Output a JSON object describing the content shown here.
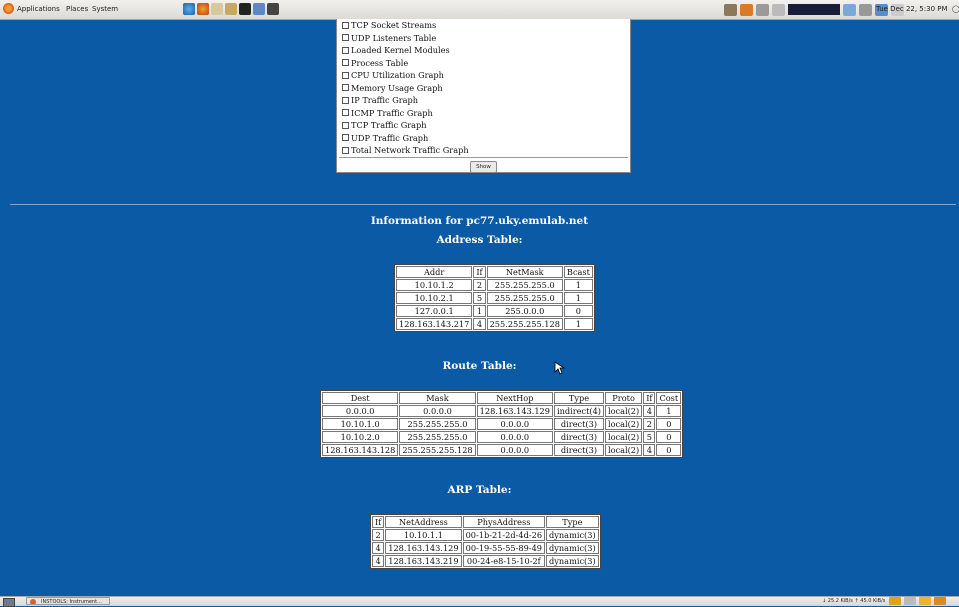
{
  "top_panel": {
    "menus": [
      "Applications",
      "Places",
      "System"
    ],
    "clock": "Tue Dec 22,  5:30 PM",
    "user": "nas"
  },
  "checkbox_options": [
    "TCP Socket Streams",
    "UDP Listeners Table",
    "Loaded Kernel Modules",
    "Process Table",
    "CPU Utilization Graph",
    "Memory Usage Graph",
    "IP Traffic Graph",
    "ICMP Traffic Graph",
    "TCP Traffic Graph",
    "UDP Traffic Graph",
    "Total Network Traffic Graph"
  ],
  "show_button": "Show",
  "info_title": "Information for pc77.uky.emulab.net",
  "address_table": {
    "title": "Address Table:",
    "headers": [
      "Addr",
      "If",
      "NetMask",
      "Bcast"
    ],
    "rows": [
      [
        "10.10.1.2",
        "2",
        "255.255.255.0",
        "1"
      ],
      [
        "10.10.2.1",
        "5",
        "255.255.255.0",
        "1"
      ],
      [
        "127.0.0.1",
        "1",
        "255.0.0.0",
        "0"
      ],
      [
        "128.163.143.217",
        "4",
        "255.255.255.128",
        "1"
      ]
    ]
  },
  "route_table": {
    "title": "Route Table:",
    "headers": [
      "Dest",
      "Mask",
      "NextHop",
      "Type",
      "Proto",
      "If",
      "Cost"
    ],
    "rows": [
      [
        "0.0.0.0",
        "0.0.0.0",
        "128.163.143.129",
        "indirect(4)",
        "local(2)",
        "4",
        "1"
      ],
      [
        "10.10.1.0",
        "255.255.255.0",
        "0.0.0.0",
        "direct(3)",
        "local(2)",
        "2",
        "0"
      ],
      [
        "10.10.2.0",
        "255.255.255.0",
        "0.0.0.0",
        "direct(3)",
        "local(2)",
        "5",
        "0"
      ],
      [
        "128.163.143.128",
        "255.255.255.128",
        "0.0.0.0",
        "direct(3)",
        "local(2)",
        "4",
        "0"
      ]
    ]
  },
  "arp_table": {
    "title": "ARP Table:",
    "headers": [
      "If",
      "NetAddress",
      "PhysAddress",
      "Type"
    ],
    "rows": [
      [
        "2",
        "10.10.1.1",
        "00-1b-21-2d-4d-26",
        "dynamic(3)"
      ],
      [
        "4",
        "128.163.143.129",
        "00-19-55-55-89-49",
        "dynamic(3)"
      ],
      [
        "4",
        "128.163.143.219",
        "00-24-e8-15-10-2f",
        "dynamic(3)"
      ]
    ]
  },
  "bottom_panel": {
    "task_label": "INSTOOLS: Instrument...",
    "download": "25.2 KiB/s",
    "upload": "45.0 KiB/s"
  },
  "colors": {
    "background": "#0b5aa6",
    "heading_text": "#ffffff"
  }
}
